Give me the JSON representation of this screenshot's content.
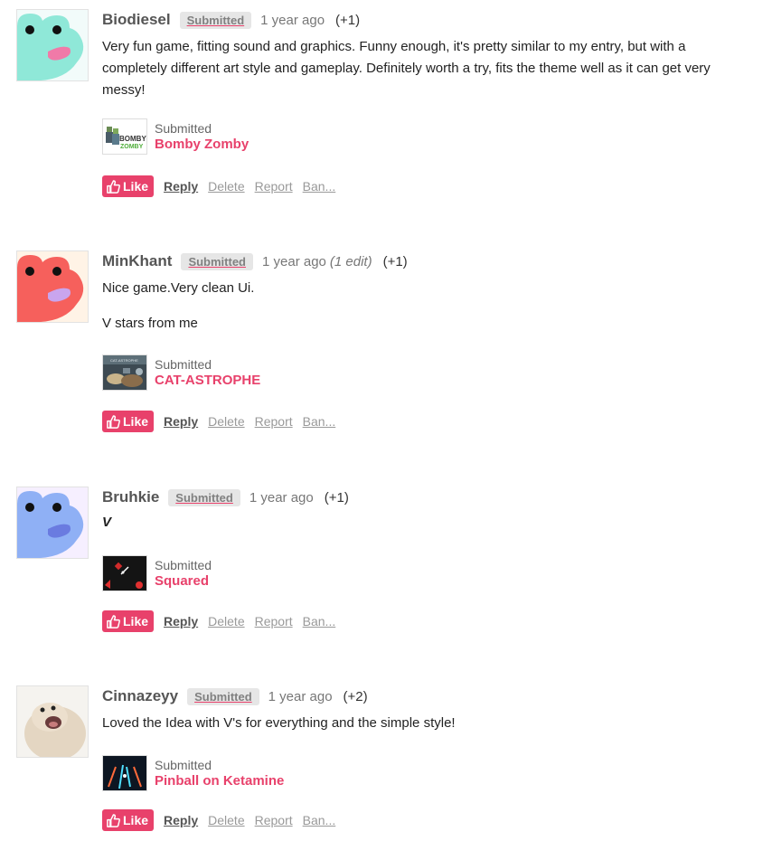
{
  "comments": [
    {
      "author": "Biodiesel",
      "badge": "Submitted",
      "time": "1 year ago",
      "edited": "",
      "votes": "(+1)",
      "avatar_color": "#8fe8d8",
      "avatar_bg": "#f2fbfa",
      "avatar_mouth": "#f07aa8",
      "paragraphs": [
        "Very fun game, fitting sound and graphics. Funny enough, it's pretty similar to my entry, but with a completely different art style and gameplay. Definitely worth a try, fits the theme well as it can get very messy!"
      ],
      "game": {
        "label": "Submitted",
        "title": "Bomby Zomby"
      },
      "actions": {
        "like": "Like",
        "reply": "Reply",
        "delete": "Delete",
        "report": "Report",
        "ban": "Ban..."
      }
    },
    {
      "author": "MinKhant",
      "badge": "Submitted",
      "time": "1 year ago",
      "edited": "(1 edit)",
      "votes": "(+1)",
      "avatar_color": "#f6605c",
      "avatar_bg": "#fff3e6",
      "avatar_mouth": "#c9a5ee",
      "paragraphs": [
        "Nice game.Very clean Ui.",
        "V stars from me"
      ],
      "game": {
        "label": "Submitted",
        "title": "CAT-ASTROPHE"
      },
      "actions": {
        "like": "Like",
        "reply": "Reply",
        "delete": "Delete",
        "report": "Report",
        "ban": "Ban..."
      }
    },
    {
      "author": "Bruhkie",
      "badge": "Submitted",
      "time": "1 year ago",
      "edited": "",
      "votes": "(+1)",
      "avatar_color": "#8fb0f5",
      "avatar_bg": "#f6efff",
      "avatar_mouth": "#6a7be0",
      "paragraphs": [
        "V"
      ],
      "game": {
        "label": "Submitted",
        "title": "Squared"
      },
      "actions": {
        "like": "Like",
        "reply": "Reply",
        "delete": "Delete",
        "report": "Report",
        "ban": "Ban..."
      }
    },
    {
      "author": "Cinnazeyy",
      "badge": "Submitted",
      "time": "1 year ago",
      "edited": "",
      "votes": "(+2)",
      "paragraphs": [
        "Loved the Idea with V's for everything and the simple style!"
      ],
      "game": {
        "label": "Submitted",
        "title": "Pinball on Ketamine"
      },
      "actions": {
        "like": "Like",
        "reply": "Reply",
        "delete": "Delete",
        "report": "Report",
        "ban": "Ban..."
      }
    }
  ],
  "accent_color": "#e8416b"
}
